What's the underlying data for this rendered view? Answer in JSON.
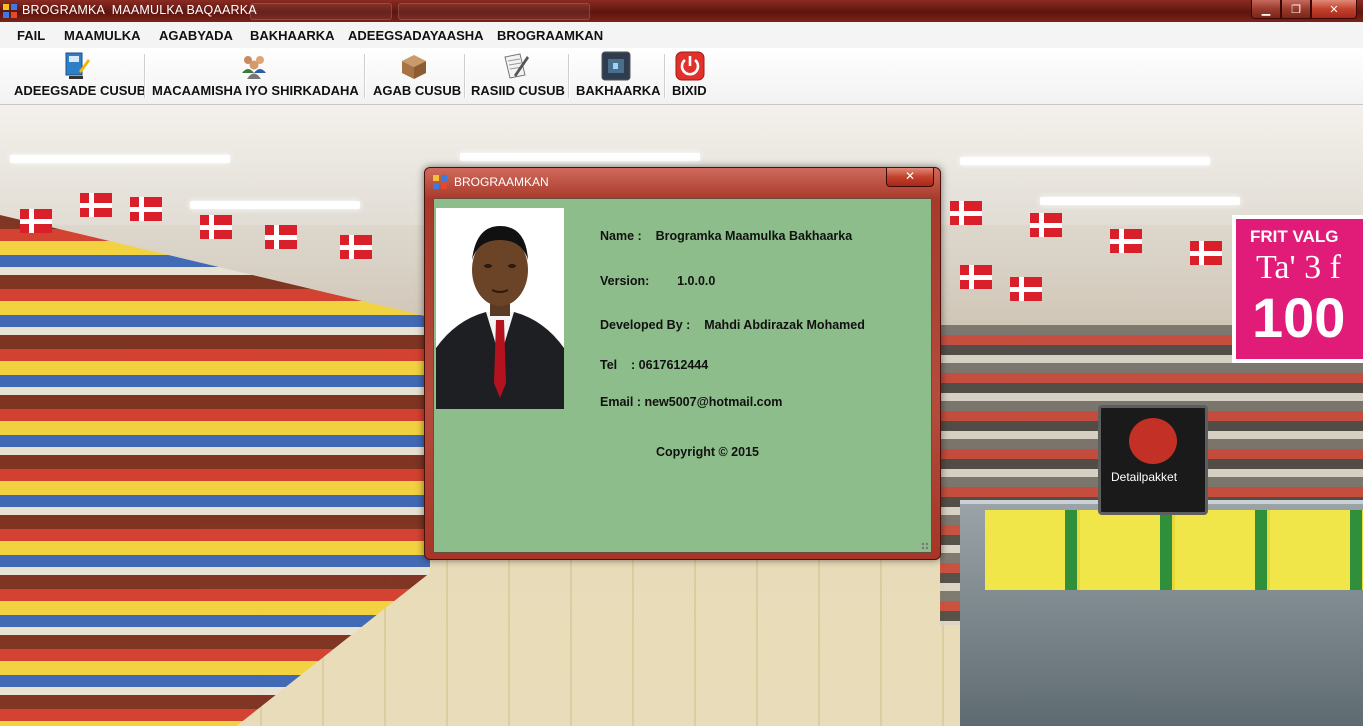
{
  "window": {
    "title": "BROGRAMKA  MAAMULKA BAQAARKA",
    "min_label": "▁",
    "max_label": "❐",
    "close_label": "✕"
  },
  "menu": {
    "items": [
      "FAIL",
      "MAAMULKA",
      "AGABYADA",
      "BAKHAARKA",
      "ADEEGSADAYAASHA",
      "BROGRAAMKAN"
    ]
  },
  "toolbar": {
    "items": [
      {
        "label": "ADEEGSADE CUSUB",
        "icon": "new-user-icon"
      },
      {
        "label": "MACAAMISHA IYO SHIRKADAHA",
        "icon": "customers-icon"
      },
      {
        "label": "AGAB CUSUB",
        "icon": "box-icon"
      },
      {
        "label": "RASIID CUSUB",
        "icon": "receipt-icon"
      },
      {
        "label": "BAKHAARKA",
        "icon": "warehouse-icon"
      },
      {
        "label": "BIXID",
        "icon": "power-icon"
      }
    ]
  },
  "background": {
    "sign_line1": "FRIT VALG",
    "sign_line2": "Ta' 3 f",
    "sign_line3": "100",
    "detail_sign": "Detailpakket"
  },
  "dialog": {
    "title": "BROGRAAMKAN",
    "close_label": "✕",
    "name_line": "Name :    Brogramka Maamulka Bakhaarka",
    "version_line": "Version:        1.0.0.0",
    "developer_line": "Developed By :    Mahdi Abdirazak Mohamed",
    "tel_line": "Tel    : 0617612444",
    "email_line": "Email : new5007@hotmail.com",
    "copyright": "Copyright © 2015"
  },
  "colors": {
    "titlebar": "#6b1a12",
    "dialog_client": "#8dbd8a",
    "accent_red": "#a8392b"
  }
}
